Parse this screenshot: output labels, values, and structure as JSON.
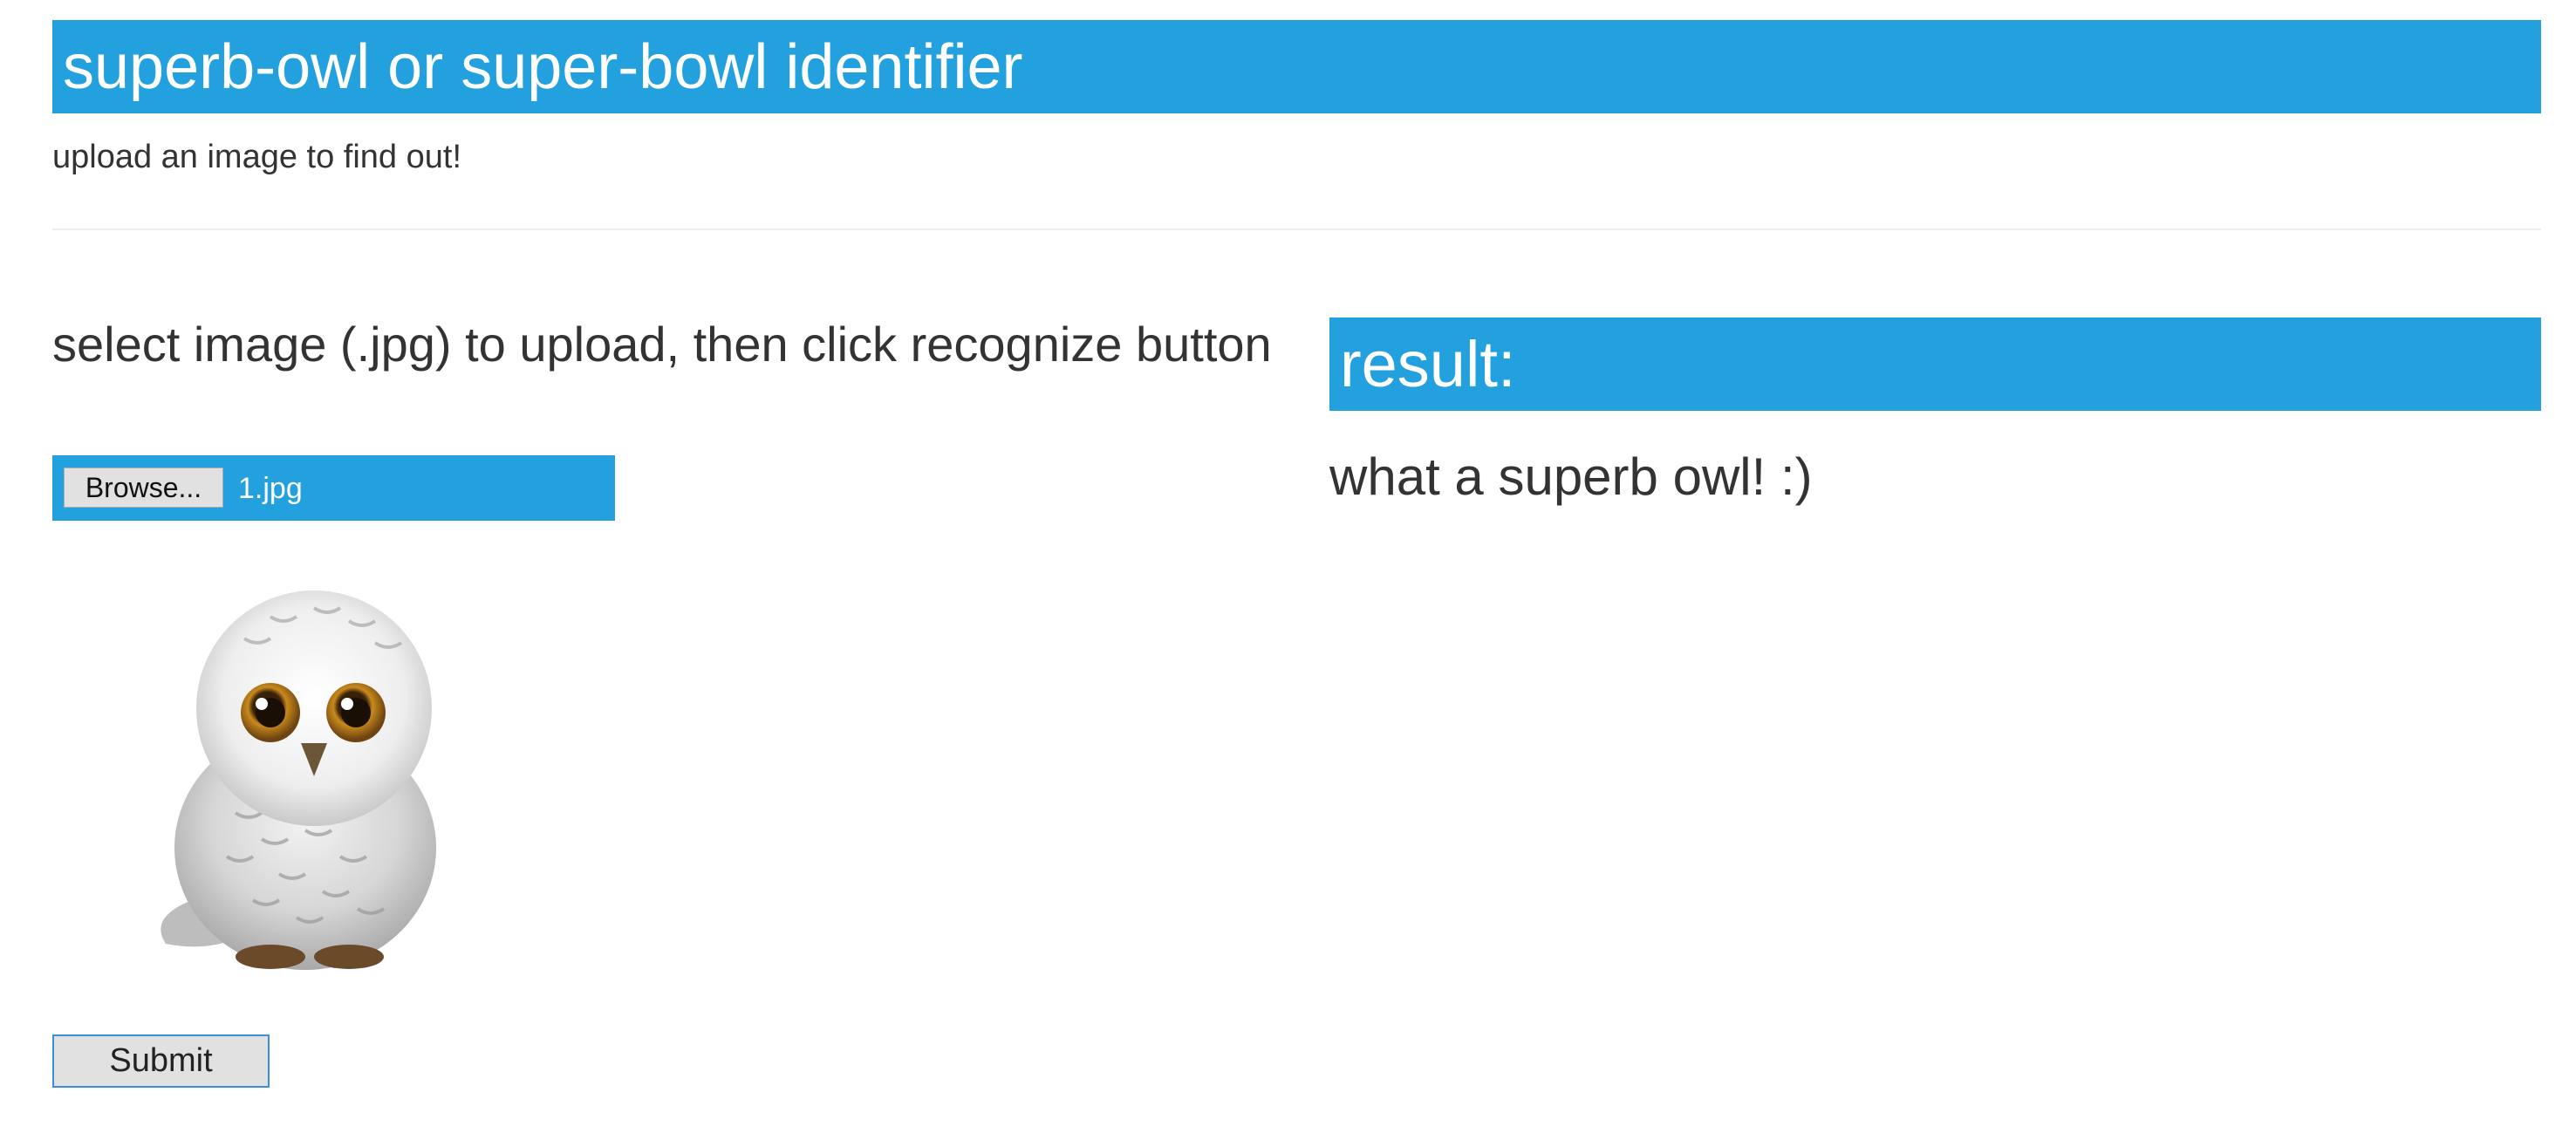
{
  "header": {
    "title": "superb-owl or super-bowl identifier",
    "background_color": "#22a1de"
  },
  "subtitle": "upload an image to find out!",
  "upload": {
    "instruction": "select image (.jpg) to upload, then click recognize button",
    "browse_label": "Browse...",
    "file_name": "1.jpg",
    "preview_icon": "owl-plush-image"
  },
  "submit_label": "Submit",
  "result": {
    "title": "result:",
    "text": "what a superb owl! :)"
  },
  "colors": {
    "accent": "#22a1de",
    "text": "#333333",
    "button_bg": "#e1e1e1"
  }
}
